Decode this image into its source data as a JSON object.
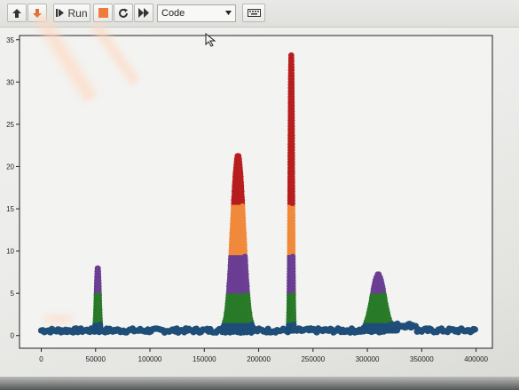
{
  "toolbar": {
    "move_up_icon": "arrow-up-icon",
    "move_down_icon": "arrow-down-icon",
    "run_label": "Run",
    "stop_icon": "stop-icon",
    "restart_icon": "restart-icon",
    "fast_forward_icon": "fast-forward-icon",
    "cell_type": "Code",
    "keyboard_icon": "keyboard-icon"
  },
  "colors": {
    "toolbar_bg": "#e4e5e1",
    "stop_orange": "#f07a3c",
    "series_blue": "#1f4e79",
    "series_green": "#2a7a2a",
    "series_purple": "#6b3f93",
    "series_orange": "#f08a3c",
    "series_red": "#b81e1e"
  },
  "chart_data": {
    "type": "scatter",
    "title": "",
    "xlabel": "",
    "ylabel": "",
    "xlim": [
      -20000,
      415000
    ],
    "ylim": [
      -1.5,
      35.5
    ],
    "x_ticks": [
      0,
      50000,
      100000,
      150000,
      200000,
      250000,
      300000,
      350000,
      400000
    ],
    "x_tick_labels": [
      "0",
      "50000",
      "100000",
      "150000",
      "200000",
      "250000",
      "300000",
      "350000",
      "400000"
    ],
    "y_ticks": [
      0,
      5,
      10,
      15,
      20,
      25,
      30,
      35
    ],
    "y_tick_labels": [
      "0",
      "5",
      "10",
      "15",
      "20",
      "25",
      "30",
      "35"
    ],
    "grid": false,
    "baseline": {
      "x_start": 0,
      "x_end": 400000,
      "y": 0.6
    },
    "spikes": [
      {
        "x": 52000,
        "peak": 8.2,
        "width": 1500
      },
      {
        "x": 181000,
        "peak": 21.5,
        "width": 7000
      },
      {
        "x": 230000,
        "peak": 33.5,
        "width": 1200
      },
      {
        "x": 310000,
        "peak": 7.3,
        "width": 8000
      }
    ],
    "series": [
      {
        "name": "",
        "color": "#1f4e79",
        "y_from": 0,
        "y_to": 1.6
      },
      {
        "name": "",
        "color": "#2a7a2a",
        "y_from": 1.6,
        "y_to": 5.0
      },
      {
        "name": "",
        "color": "#6b3f93",
        "y_from": 5.0,
        "y_to": 9.5
      },
      {
        "name": "",
        "color": "#f08a3c",
        "y_from": 9.5,
        "y_to": 15.5
      },
      {
        "name": "",
        "color": "#b81e1e",
        "y_from": 15.5,
        "y_to": 36
      }
    ]
  }
}
